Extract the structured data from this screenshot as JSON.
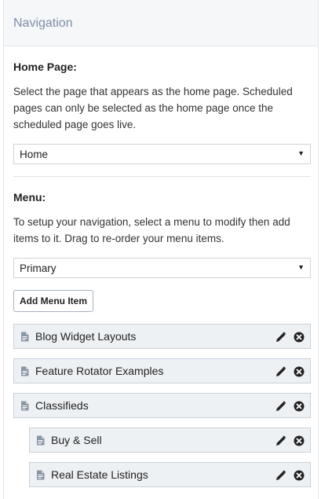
{
  "panel": {
    "title": "Navigation"
  },
  "home_page": {
    "label": "Home Page:",
    "description": "Select the page that appears as the home page. Scheduled pages can only be selected as the home page once the scheduled page goes live.",
    "select_value": "Home"
  },
  "menu": {
    "label": "Menu:",
    "description": "To setup your navigation, select a menu to modify then add items to it. Drag to re-order your menu items.",
    "select_value": "Primary",
    "add_button_label": "Add Menu Item",
    "items": [
      {
        "label": "Blog Widget Layouts",
        "level": 0
      },
      {
        "label": "Feature Rotator Examples",
        "level": 0
      },
      {
        "label": "Classifieds",
        "level": 0
      },
      {
        "label": "Buy & Sell",
        "level": 1
      },
      {
        "label": "Real Estate Listings",
        "level": 1
      }
    ]
  },
  "icons": {
    "item": "document-icon",
    "edit": "pencil-icon",
    "remove": "remove-circle-icon",
    "select": "caret-down-icon"
  },
  "colors": {
    "header_title": "#7a8ea8",
    "item_bg": "#eef1f4",
    "item_border": "#c9d1da"
  }
}
